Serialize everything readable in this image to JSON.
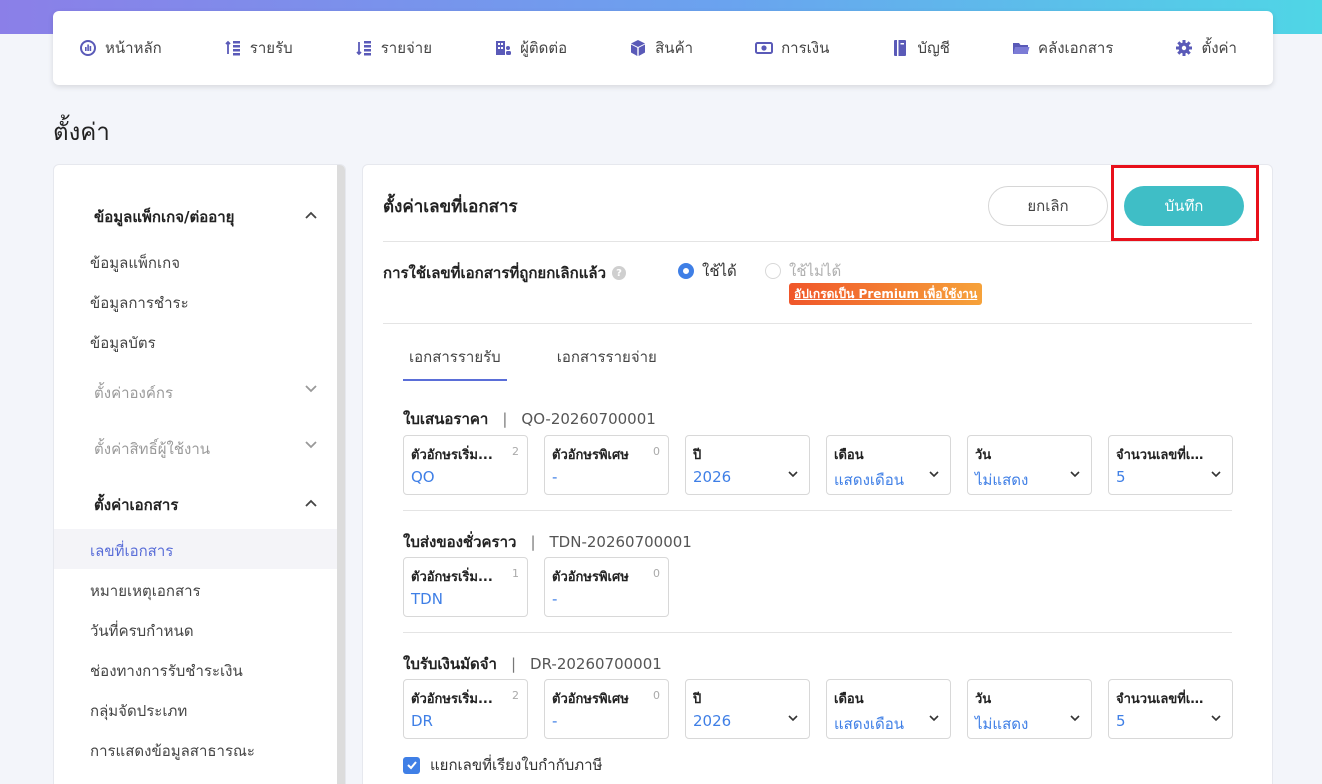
{
  "nav": [
    {
      "label": "หน้าหลัก",
      "icon": "dashboard-icon"
    },
    {
      "label": "รายรับ",
      "icon": "income-icon"
    },
    {
      "label": "รายจ่าย",
      "icon": "expense-icon"
    },
    {
      "label": "ผู้ติดต่อ",
      "icon": "contacts-icon"
    },
    {
      "label": "สินค้า",
      "icon": "box-icon"
    },
    {
      "label": "การเงิน",
      "icon": "money-icon"
    },
    {
      "label": "บัญชี",
      "icon": "ledger-icon"
    },
    {
      "label": "คลังเอกสาร",
      "icon": "folder-icon"
    },
    {
      "label": "ตั้งค่า",
      "icon": "gear-icon"
    }
  ],
  "page": {
    "title": "ตั้งค่า"
  },
  "sidebar": {
    "group_package": "ข้อมูลแพ็กเกจ/ต่ออายุ",
    "item_package": "ข้อมูลแพ็กเกจ",
    "item_payment": "ข้อมูลการชำระ",
    "item_card": "ข้อมูลบัตร",
    "group_org": "ตั้งค่าองค์กร",
    "group_rights": "ตั้งค่าสิทธิ์ผู้ใช้งาน",
    "group_docs": "ตั้งค่าเอกสาร",
    "item_docnum": "เลขที่เอกสาร",
    "item_docnote": "หมายเหตุเอกสาร",
    "item_duedate": "วันที่ครบกำหนด",
    "item_paychannel": "ช่องทางการรับชำระเงิน",
    "item_category": "กลุ่มจัดประเภท",
    "item_public": "การแสดงข้อมูลสาธารณะ"
  },
  "panel": {
    "title": "ตั้งค่าเลขที่เอกสาร",
    "cancel": "ยกเลิก",
    "save": "บันทึก",
    "reuse_label": "การใช้เลขที่เอกสารที่ถูกยกเลิกแล้ว",
    "radio_on": "ใช้ได้",
    "radio_off": "ใช้ไม่ได้",
    "premium": "อัปเกรดเป็น Premium เพื่อใช้งาน",
    "tab_income": "เอกสารรายรับ",
    "tab_expense": "เอกสารรายจ่าย",
    "checkbox_label": "แยกเลขที่เรียงใบกำกับภาษี"
  },
  "labels": {
    "prefix": "ตัวอักษรเริ่ม...",
    "special": "ตัวอักษรพิเศษ",
    "year": "ปี",
    "month": "เดือน",
    "day": "วัน",
    "count": "จำนวนเลขที่เอ..."
  },
  "docs": {
    "quotation": {
      "name": "ใบเสนอราคา",
      "code": "QO-20260700001",
      "prefix": "QO",
      "prefix_count": "2",
      "special": "-",
      "special_count": "0",
      "year": "2026",
      "month": "แสดงเดือน",
      "day": "ไม่แสดง",
      "digits": "5"
    },
    "delivery": {
      "name": "ใบส่งของชั่วคราว",
      "code": "TDN-20260700001",
      "prefix": "TDN",
      "prefix_count": "1",
      "special": "-",
      "special_count": "0"
    },
    "deposit": {
      "name": "ใบรับเงินมัดจำ",
      "code": "DR-20260700001",
      "prefix": "DR",
      "prefix_count": "2",
      "special": "-",
      "special_count": "0",
      "year": "2026",
      "month": "แสดงเดือน",
      "day": "ไม่แสดง",
      "digits": "5"
    }
  },
  "colors": {
    "accent": "#3fbec6",
    "link": "#3f7fe6",
    "highlight": "#e8101b"
  }
}
